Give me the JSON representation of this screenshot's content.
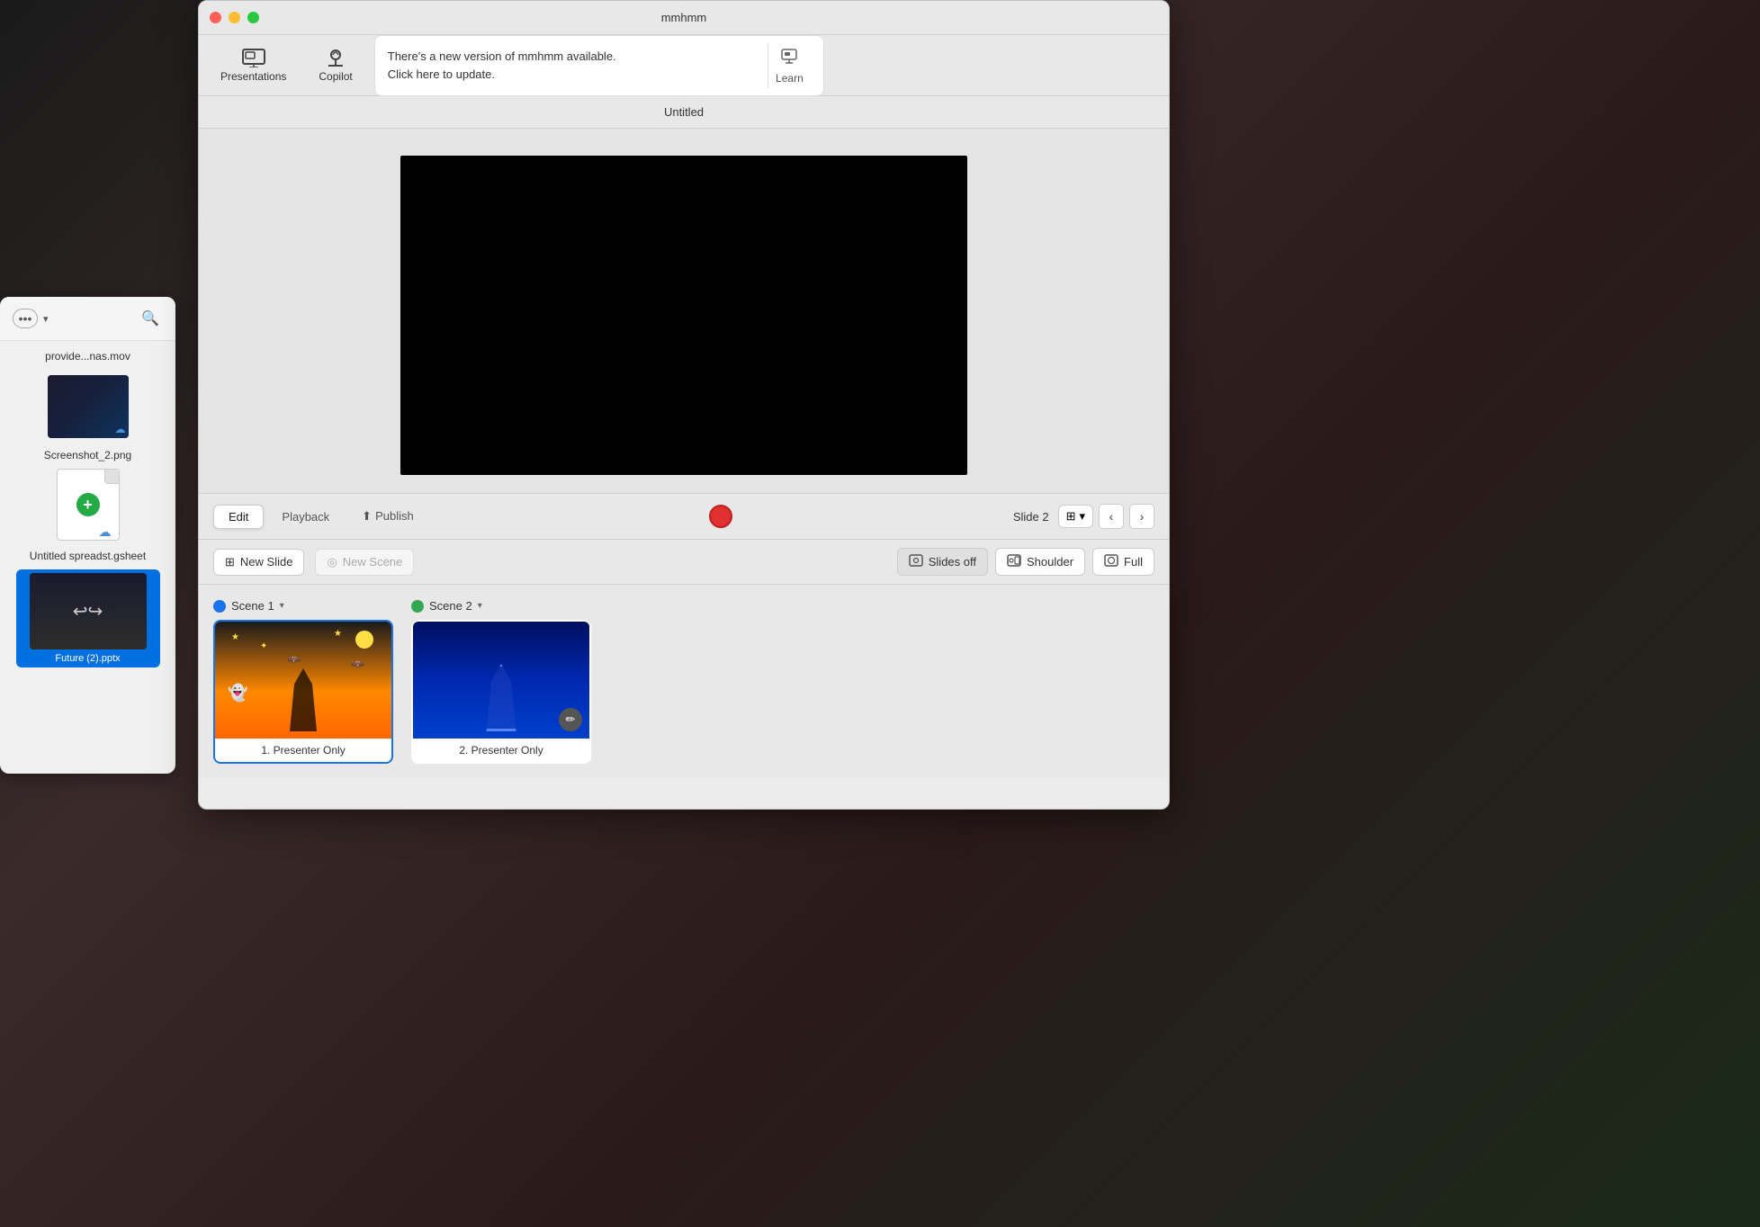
{
  "app": {
    "title": "mmhmm",
    "window_title": "Untitled"
  },
  "window_controls": {
    "close_label": "",
    "minimize_label": "",
    "maximize_label": ""
  },
  "toolbar": {
    "presentations_label": "Presentations",
    "copilot_label": "Copilot"
  },
  "update_banner": {
    "message": "There's a new version of mmhmm available.\nClick here to update.",
    "learn_label": "Learn"
  },
  "edit_bar": {
    "edit_tab": "Edit",
    "playback_tab": "Playback",
    "publish_tab": "Publish",
    "slide_label": "Slide 2"
  },
  "slides_toolbar": {
    "new_slide_label": "New Slide",
    "new_scene_label": "New Scene",
    "slides_off_label": "Slides off",
    "shoulder_label": "Shoulder",
    "full_label": "Full"
  },
  "scenes": [
    {
      "id": "scene1",
      "label": "Scene 1",
      "dot_type": "blue",
      "slides": [
        {
          "id": "slide1",
          "label": "1. Presenter Only",
          "theme": "halloween"
        }
      ]
    },
    {
      "id": "scene2",
      "label": "Scene 2",
      "dot_type": "green",
      "slides": [
        {
          "id": "slide2",
          "label": "2. Presenter Only",
          "theme": "blue"
        }
      ]
    }
  ],
  "finder_panel": {
    "file1_name": "provide...nas.mov",
    "file2_name": "Screenshot_2.png",
    "file3_name": "Untitled\nspreadst.gsheet",
    "file4_name": "Future (2).pptx"
  }
}
